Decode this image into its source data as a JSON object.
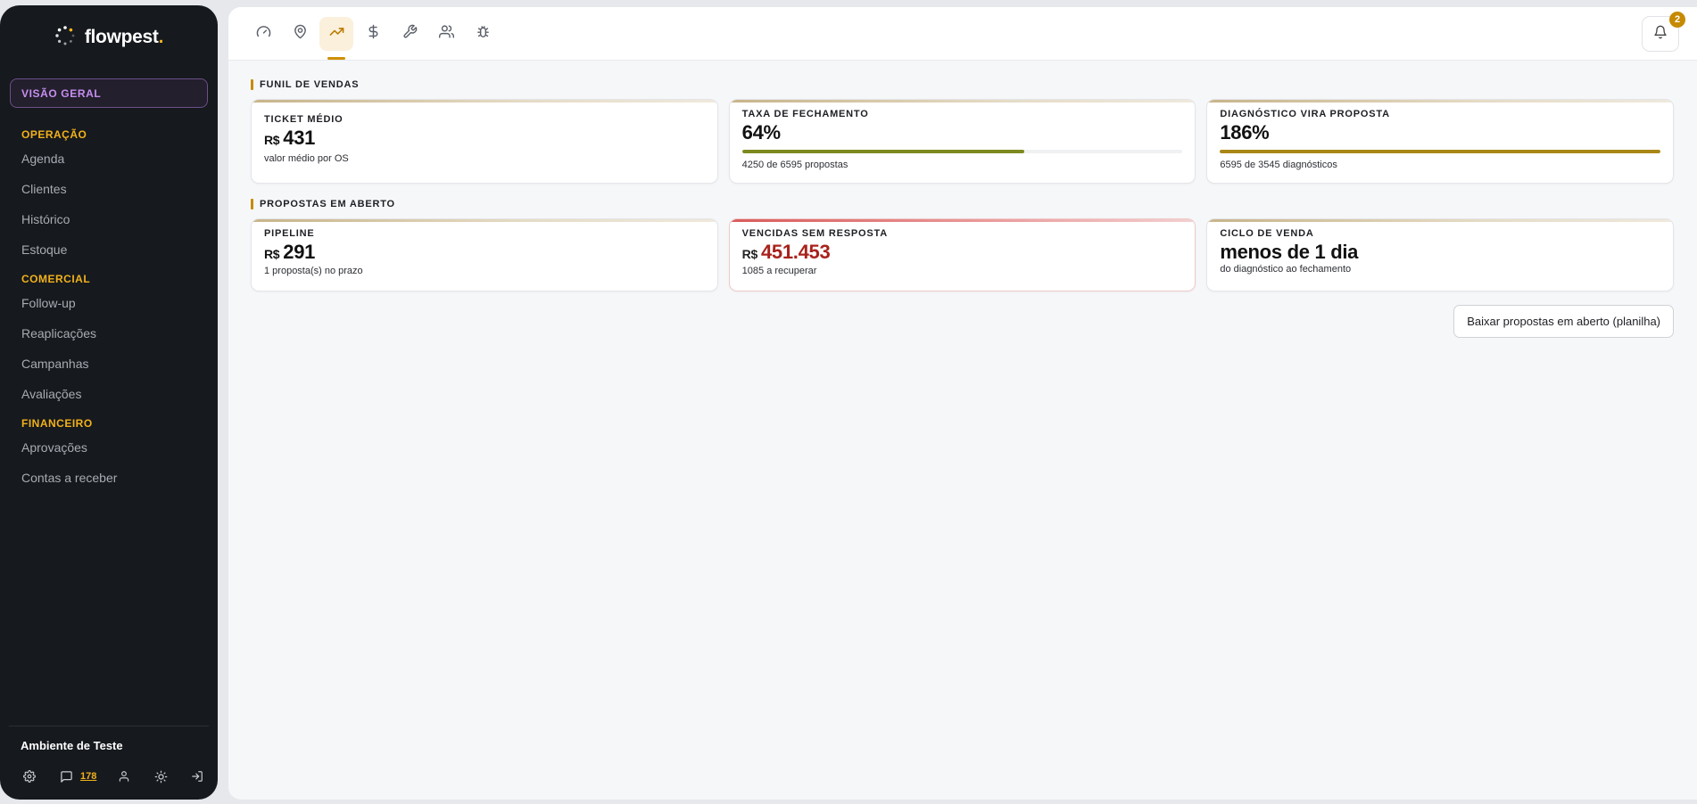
{
  "brand": {
    "name": "flowpest",
    "dot": "."
  },
  "sidebar": {
    "overview_label": "VISÃO GERAL",
    "sections": [
      {
        "title": "OPERAÇÃO",
        "items": [
          "Agenda",
          "Clientes",
          "Histórico",
          "Estoque"
        ]
      },
      {
        "title": "COMERCIAL",
        "items": [
          "Follow-up",
          "Reaplicações",
          "Campanhas",
          "Avaliações"
        ]
      },
      {
        "title": "FINANCEIRO",
        "items": [
          "Aprovações",
          "Contas a receber"
        ]
      }
    ],
    "environment": "Ambiente de Teste",
    "chat_count": "178"
  },
  "topbar": {
    "tabs": [
      "gauge-icon",
      "map-pin-icon",
      "trending-up-icon",
      "dollar-icon",
      "wrench-icon",
      "users-icon",
      "bug-icon"
    ],
    "active_tab": 2,
    "notification_count": "2"
  },
  "funnel": {
    "title": "FUNIL DE VENDAS",
    "ticket": {
      "label": "TICKET MÉDIO",
      "currency": "R$",
      "value": "431",
      "sub": "valor médio por OS"
    },
    "closing": {
      "label": "TAXA DE FECHAMENTO",
      "value": "64%",
      "progress": 0.64,
      "sub": "4250 de 6595 propostas"
    },
    "diagnosis": {
      "label": "DIAGNÓSTICO VIRA PROPOSTA",
      "value": "186%",
      "progress": 1.0,
      "sub": "6595 de 3545 diagnósticos"
    }
  },
  "open_proposals": {
    "title": "PROPOSTAS EM ABERTO",
    "pipeline": {
      "label": "PIPELINE",
      "currency": "R$",
      "value": "291",
      "sub": "1 proposta(s) no prazo"
    },
    "overdue": {
      "label": "VENCIDAS SEM RESPOSTA",
      "currency": "R$",
      "value": "451.453",
      "sub": "1085 a recuperar"
    },
    "cycle": {
      "label": "CICLO DE VENDA",
      "value": "menos de 1 dia",
      "sub": "do diagnóstico ao fechamento"
    }
  },
  "download_label": "Baixar propostas em aberto (planilha)",
  "colors": {
    "accent": "#f1b11c",
    "overview": "#c68ef0",
    "danger": "#a8221c",
    "progress_green": "#7d8a1f",
    "progress_gold": "#a88714"
  }
}
